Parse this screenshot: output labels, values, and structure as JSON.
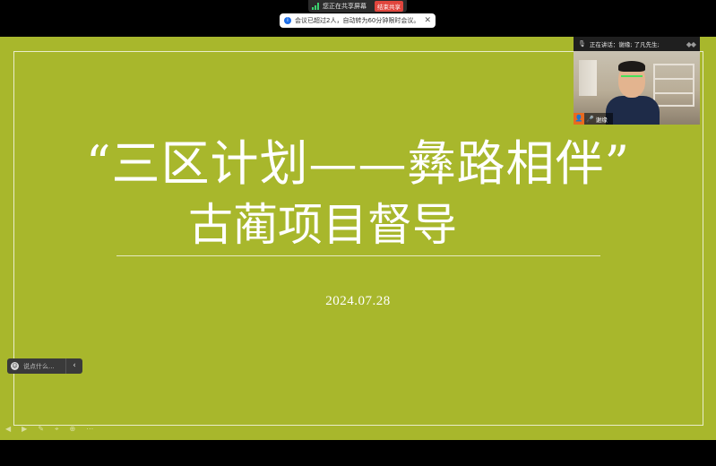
{
  "share_bar": {
    "status": "您正在共享屏幕",
    "end_button": "结束共享"
  },
  "notice": {
    "text": "会议已超过2人，自动转为60分钟限时会议。"
  },
  "slide": {
    "title_line1": "“三区计划——彝路相伴”",
    "title_line2": "古蔺项目督导",
    "date": "2024.07.28"
  },
  "chat": {
    "placeholder": "说点什么..."
  },
  "video_panel": {
    "speaking": "正在讲话：谢缘; 了凡先生;",
    "participant_name": "谢缘"
  },
  "colors": {
    "slide_bg": "#a8b72c",
    "end_share": "#e0453d",
    "accent_green": "#3bd16f"
  }
}
